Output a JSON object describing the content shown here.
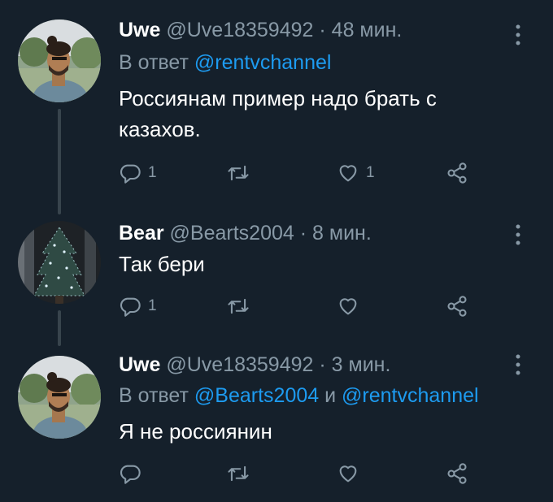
{
  "tweets": [
    {
      "name": "Uwe",
      "handle": "@Uve18359492",
      "dot": "·",
      "time": "48 мин.",
      "reply_prefix": "В ответ",
      "reply_mentions": [
        "@rentvchannel"
      ],
      "reply_conj": "",
      "text": "Россиянам пример надо брать с казахов.",
      "reply_count": "1",
      "retweet_count": "",
      "like_count": "1"
    },
    {
      "name": "Bear",
      "handle": "@Bearts2004",
      "dot": "·",
      "time": "8 мин.",
      "text": "Так бери",
      "reply_count": "1",
      "retweet_count": "",
      "like_count": ""
    },
    {
      "name": "Uwe",
      "handle": "@Uve18359492",
      "dot": "·",
      "time": "3 мин.",
      "reply_prefix": "В ответ",
      "reply_mentions": [
        "@Bearts2004",
        "@rentvchannel"
      ],
      "reply_conj": "и",
      "text": "Я не россиянин",
      "reply_count": "",
      "retweet_count": "",
      "like_count": ""
    }
  ],
  "colors": {
    "background": "#15202b",
    "secondary_text": "#8899a6",
    "link": "#1d9bf0",
    "thread_line": "#38444d"
  },
  "icons": [
    "more-icon",
    "reply-icon",
    "retweet-icon",
    "like-icon",
    "share-icon"
  ]
}
